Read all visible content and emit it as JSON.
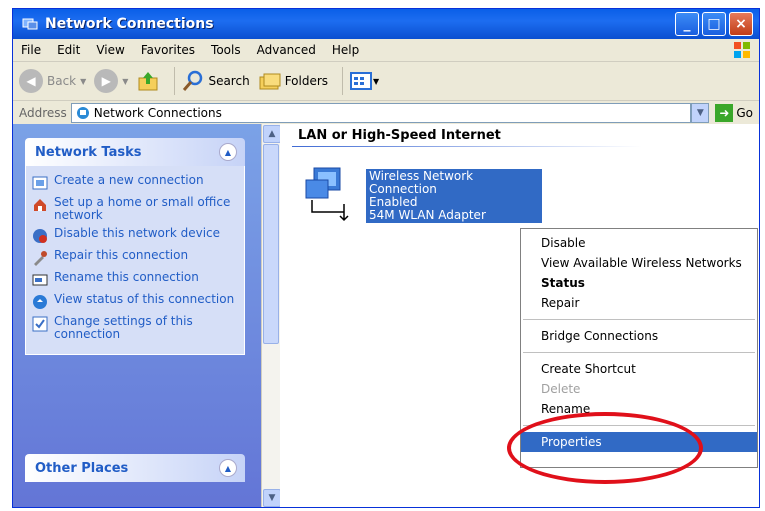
{
  "window": {
    "title": "Network Connections"
  },
  "menu": [
    "File",
    "Edit",
    "View",
    "Favorites",
    "Tools",
    "Advanced",
    "Help"
  ],
  "toolbar": {
    "back": "Back",
    "search": "Search",
    "folders": "Folders"
  },
  "address": {
    "label": "Address",
    "value": "Network Connections",
    "go": "Go"
  },
  "network_tasks": {
    "title": "Network Tasks",
    "items": [
      "Create a new connection",
      "Set up a home or small office network",
      "Disable this network device",
      "Repair this connection",
      "Rename this connection",
      "View status of this connection",
      "Change settings of this connection"
    ]
  },
  "other_places": {
    "title": "Other Places"
  },
  "content": {
    "group": "LAN or High-Speed Internet",
    "connection": {
      "name": "Wireless Network Connection",
      "status": "Enabled",
      "adapter": "54M WLAN Adapter"
    }
  },
  "context_menu": {
    "disable": "Disable",
    "view_networks": "View Available Wireless Networks",
    "status": "Status",
    "repair": "Repair",
    "bridge": "Bridge Connections",
    "shortcut": "Create Shortcut",
    "delete": "Delete",
    "rename": "Rename",
    "properties": "Properties"
  },
  "colors": {
    "titlebar": "#0a5fe8",
    "taskpane": "#6b8ee0",
    "selection": "#316ac5",
    "highlight": "#e0101a"
  }
}
